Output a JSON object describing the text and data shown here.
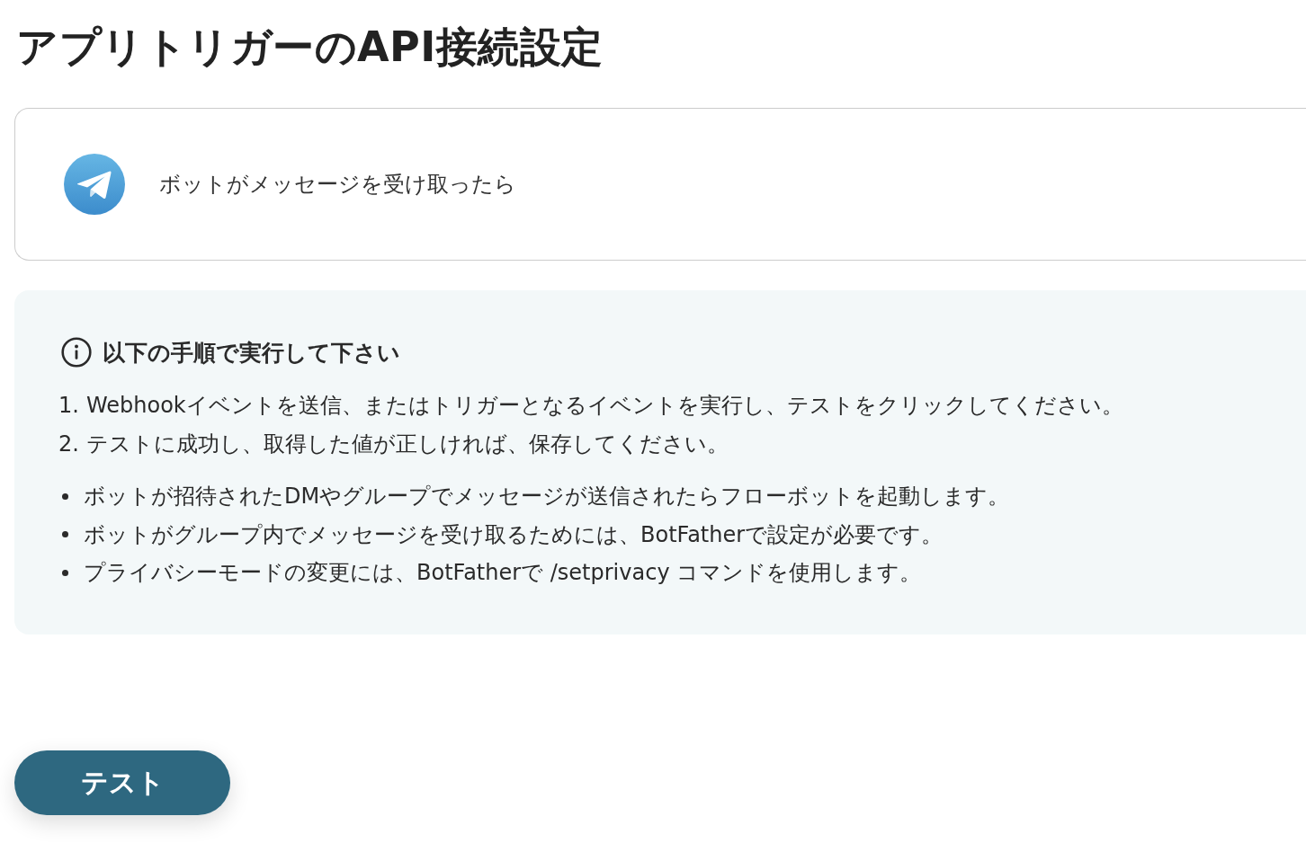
{
  "page_title": "アプリトリガーのAPI接続設定",
  "trigger": {
    "label": "ボットがメッセージを受け取ったら"
  },
  "instructions": {
    "heading": "以下の手順で実行して下さい",
    "steps": [
      {
        "number": "1.",
        "text": "Webhookイベントを送信、またはトリガーとなるイベントを実行し、テストをクリックしてください。"
      },
      {
        "number": "2.",
        "text": "テストに成功し、取得した値が正しければ、保存してください。"
      }
    ],
    "notes": [
      "ボットが招待されたDMやグループでメッセージが送信されたらフローボットを起動します。",
      "ボットがグループ内でメッセージを受け取るためには、BotFatherで設定が必要です。",
      "プライバシーモードの変更には、BotFatherで /setprivacy コマンドを使用します。"
    ]
  },
  "test_button": {
    "label": "テスト"
  }
}
